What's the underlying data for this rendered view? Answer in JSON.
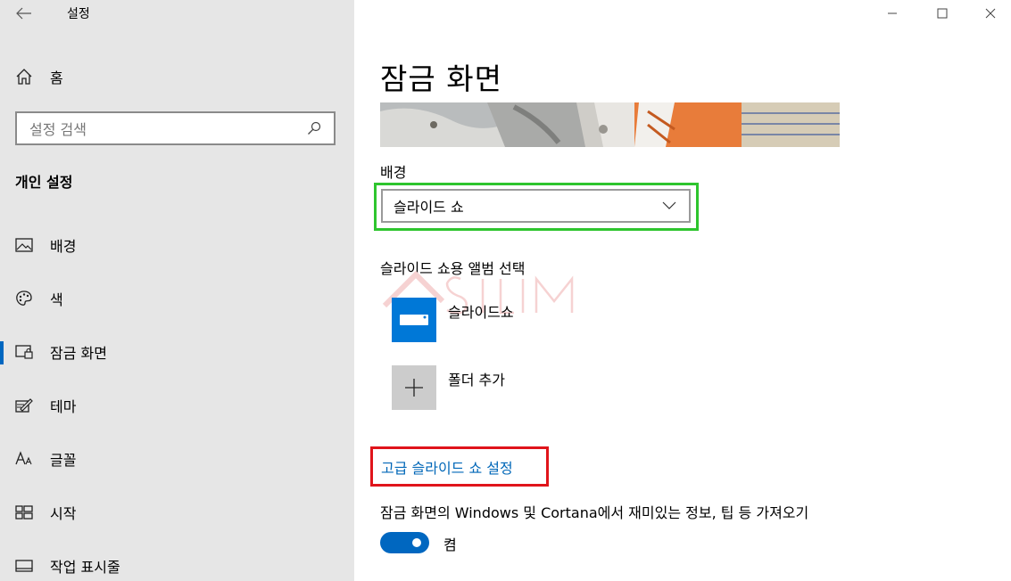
{
  "window": {
    "title": "설정"
  },
  "sidebar": {
    "home_label": "홈",
    "search_placeholder": "설정 검색",
    "section_title": "개인 설정",
    "items": [
      {
        "label": "배경",
        "icon": "image-icon"
      },
      {
        "label": "색",
        "icon": "palette-icon"
      },
      {
        "label": "잠금 화면",
        "icon": "lock-screen-icon",
        "active": true
      },
      {
        "label": "테마",
        "icon": "theme-icon"
      },
      {
        "label": "글꼴",
        "icon": "font-icon"
      },
      {
        "label": "시작",
        "icon": "start-icon"
      },
      {
        "label": "작업 표시줄",
        "icon": "taskbar-icon"
      }
    ]
  },
  "main": {
    "title": "잠금 화면",
    "background_label": "배경",
    "background_value": "슬라이드 쇼",
    "album_label": "슬라이드 쇼용 앨범 선택",
    "albums": [
      {
        "label": "슬라이드쇼",
        "icon": "picture-folder-icon"
      },
      {
        "label": "폴더 추가",
        "icon": "plus-icon"
      }
    ],
    "advanced_link": "고급 슬라이드 쇼 설정",
    "tips_label": "잠금 화면의 Windows 및 Cortana에서 재미있는 정보, 팁 등 가져오기",
    "tips_toggle_state": "켬"
  },
  "colors": {
    "accent": "#0067c0",
    "link": "#0067b8",
    "highlight_green": "#2ec52e",
    "highlight_red": "#e0141b"
  }
}
